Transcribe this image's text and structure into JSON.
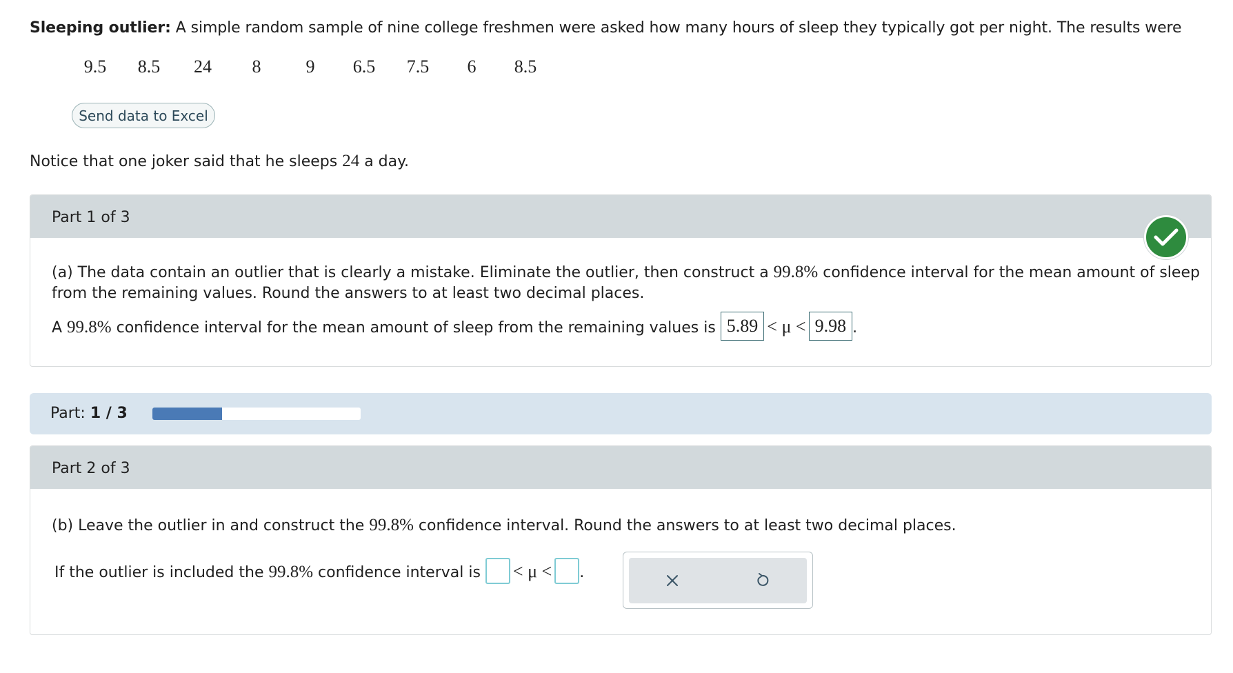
{
  "problem": {
    "title": "Sleeping outlier:",
    "intro": "A simple random sample of nine college freshmen were asked how many hours of sleep they typically got per night. The results were",
    "data_values": [
      "9.5",
      "8.5",
      "24",
      "8",
      "9",
      "6.5",
      "7.5",
      "6",
      "8.5"
    ],
    "excel_button": "Send data to Excel",
    "notice_before": "Notice that one joker said that he sleeps ",
    "notice_value": "24",
    "notice_after": " a day."
  },
  "part1": {
    "header": "Part 1 of 3",
    "question_line1_a": "(a) The data contain an outlier that is clearly a mistake. Eliminate the outlier, then construct a ",
    "question_pct": "99.8%",
    "question_line1_b": " confidence interval for the mean amount of sleep",
    "question_line2": "from the remaining values. Round the answers to at least two decimal places.",
    "answer_prefix_a": "A ",
    "answer_pct": "99.8%",
    "answer_prefix_b": " confidence interval for the mean amount of sleep from the remaining values is ",
    "lower": "5.89",
    "mu_symbol": "< μ <",
    "upper": "9.98",
    "period": "."
  },
  "progress": {
    "label": "Part:",
    "value": "1 / 3",
    "fraction": 0.333
  },
  "part2": {
    "header": "Part 2 of 3",
    "question_a": "(b) Leave the outlier in and construct the ",
    "question_pct": "99.8%",
    "question_b": " confidence interval. Round the answers to at least two decimal places.",
    "answer_a": "If the outlier is included the ",
    "answer_pct": "99.8%",
    "answer_b": " confidence interval is ",
    "mu_symbol": "< μ <",
    "period": "."
  },
  "icons": {
    "check": "check-icon",
    "clear": "close-icon",
    "reset": "undo-icon"
  },
  "colors": {
    "check_green": "#2e8b3e",
    "progress_fill": "#4a7ab6",
    "empty_box_border": "#7fcbd4"
  }
}
